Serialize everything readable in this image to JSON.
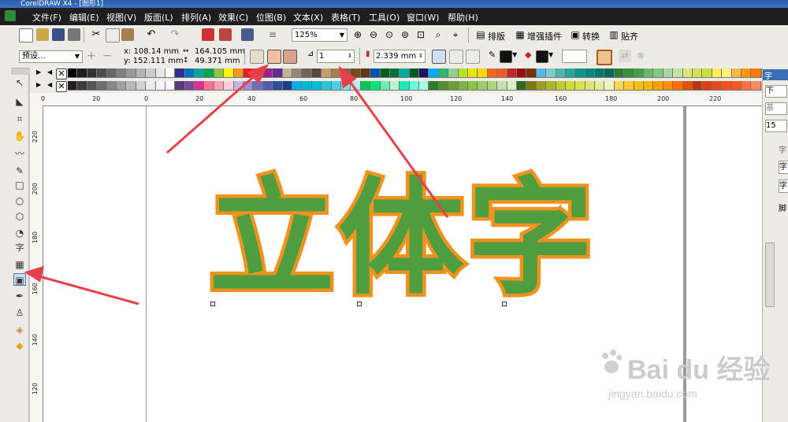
{
  "window": {
    "title": "CorelDRAW X4 - [图形1]"
  },
  "menu": [
    "文件(F)",
    "编辑(E)",
    "视图(V)",
    "版面(L)",
    "排列(A)",
    "效果(C)",
    "位图(B)",
    "文本(X)",
    "表格(T)",
    "工具(O)",
    "窗口(W)",
    "帮助(H)"
  ],
  "standard_toolbar": {
    "zoom_value": "125%",
    "buttons": [
      "排版",
      "增强插件",
      "转换",
      "贴齐"
    ]
  },
  "property_bar": {
    "preset": "预设...",
    "x": "x: 108.14 mm",
    "y": "y: 152.111 mm",
    "width": "164.105 mm",
    "height": "49.371 mm",
    "miter": "1",
    "outline_width": "2.339 mm"
  },
  "palette": {
    "row1": [
      "#000000",
      "#1c1c1c",
      "#333333",
      "#4d4d4d",
      "#666666",
      "#808080",
      "#999999",
      "#b3b3b3",
      "#cccccc",
      "#e6e6e6",
      "#ffffff",
      "#2e3192",
      "#0072bc",
      "#00a99d",
      "#00a651",
      "#8dc63f",
      "#fff200",
      "#f7941d",
      "#ed1c24",
      "#ec008c",
      "#92278f",
      "#662d91",
      "#c7b299",
      "#998675",
      "#736357",
      "#534741",
      "#c69c6d",
      "#a67c52",
      "#8c6239",
      "#754c24",
      "#603913",
      "#0054a6",
      "#005e20",
      "#007236",
      "#00a99d",
      "#005826",
      "#1b1464",
      "#00aeef",
      "#2bb673",
      "#8fd18f",
      "#b5e61d",
      "#e6e600",
      "#ffd700",
      "#f26522",
      "#f15a24",
      "#c1272d",
      "#9e0b0f",
      "#7b2e00",
      "#56b8e6",
      "#7accc8",
      "#4db6ac",
      "#26a69a",
      "#009688",
      "#00897b",
      "#00796b",
      "#00695c",
      "#2e7d32",
      "#388e3c",
      "#43a047",
      "#66bb6a",
      "#81c784",
      "#a5d6a7",
      "#c5e1a5",
      "#dce775",
      "#d4e157",
      "#cddc39",
      "#ffee58",
      "#fff176",
      "#ffb74d",
      "#ff9800",
      "#f57c00",
      "#ef6c00"
    ],
    "row2": [
      "#231f20",
      "#3c3c3c",
      "#555555",
      "#6e6e6e",
      "#878787",
      "#a0a0a0",
      "#b9b9b9",
      "#d2d2d2",
      "#ebebeb",
      "#f5f5f5",
      "#ffffff",
      "#5b3a7a",
      "#7a4a9a",
      "#e0308f",
      "#ff6f91",
      "#f7a1b3",
      "#fdd0d8",
      "#c6b6e6",
      "#9b8fcf",
      "#6f6fb8",
      "#4f5fa8",
      "#2f4f98",
      "#1f3f88",
      "#00aeef",
      "#00b8d4",
      "#00bcd4",
      "#26c6da",
      "#4dd0e1",
      "#80deea",
      "#b2ebf2",
      "#00c853",
      "#00e676",
      "#69f0ae",
      "#b9f6ca",
      "#1de9b6",
      "#64ffda",
      "#a7ffeb",
      "#2e7d32",
      "#558b2f",
      "#689f38",
      "#7cb342",
      "#8bc34a",
      "#9ccc65",
      "#aed581",
      "#c5e1a5",
      "#dcedc8",
      "#33691e",
      "#827717",
      "#9e9d24",
      "#afb42b",
      "#c0ca33",
      "#cddc39",
      "#d4e157",
      "#dce775",
      "#e6ee9c",
      "#f0f4c3",
      "#ffd54f",
      "#ffca28",
      "#ffc107",
      "#ffb300",
      "#ffa000",
      "#ff8f00",
      "#ff6f00",
      "#e65100",
      "#bf360c",
      "#d84315",
      "#e64a19",
      "#f4511e",
      "#ff5722",
      "#ff7043",
      "#ff8a65",
      "#ffab91"
    ]
  },
  "rulers": {
    "horizontal": [
      "0",
      "20",
      "0",
      "20",
      "40",
      "60",
      "80",
      "100",
      "120",
      "140",
      "160",
      "180",
      "200",
      "220"
    ],
    "vertical": [
      "220",
      "200",
      "180",
      "160",
      "140",
      "120",
      "100"
    ]
  },
  "canvas": {
    "artwork_text": "立体字",
    "fill_color": "#4e9e3f",
    "outline_color": "#f0921d"
  },
  "docker": {
    "labels": [
      "字",
      "下",
      "基",
      "15",
      "字",
      "字",
      "字",
      "脚"
    ]
  },
  "watermark": {
    "brand": "Bai du 经验",
    "url": "jingyan.baidu.com"
  }
}
